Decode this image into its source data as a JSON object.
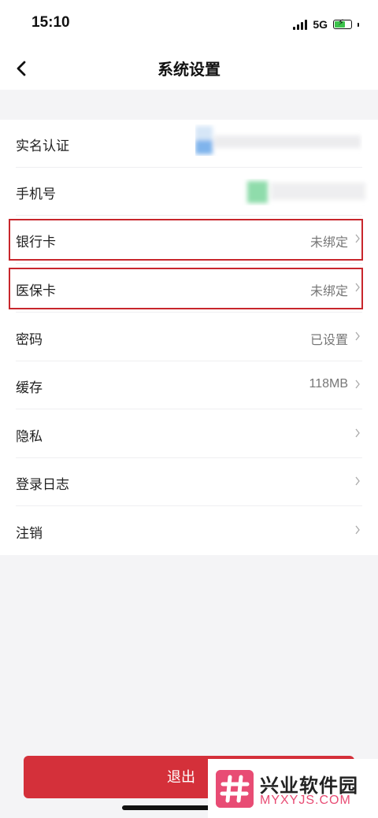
{
  "status_bar": {
    "time": "15:10",
    "network": "5G",
    "icons": [
      "signal-icon",
      "battery-charging-icon"
    ],
    "battery_color": "#3cc24b"
  },
  "header": {
    "title": "系统设置",
    "back_icon": "chevron-left-icon"
  },
  "settings": {
    "items": [
      {
        "label": "实名认证",
        "value": ""
      },
      {
        "label": "手机号",
        "value": ""
      },
      {
        "label": "银行卡",
        "value": "未绑定",
        "highlighted": true
      },
      {
        "label": "医保卡",
        "value": "未绑定",
        "highlighted": true
      },
      {
        "label": "密码",
        "value": "已设置"
      },
      {
        "label": "缓存",
        "value": "118MB"
      },
      {
        "label": "隐私",
        "value": ""
      },
      {
        "label": "登录日志",
        "value": ""
      },
      {
        "label": "注销",
        "value": ""
      }
    ]
  },
  "footer": {
    "logout_label": "退出",
    "button_color": "#d4303a"
  },
  "watermark": {
    "name": "兴业软件园",
    "url": "MYXYJS.COM",
    "accent_color": "#e84c74"
  }
}
